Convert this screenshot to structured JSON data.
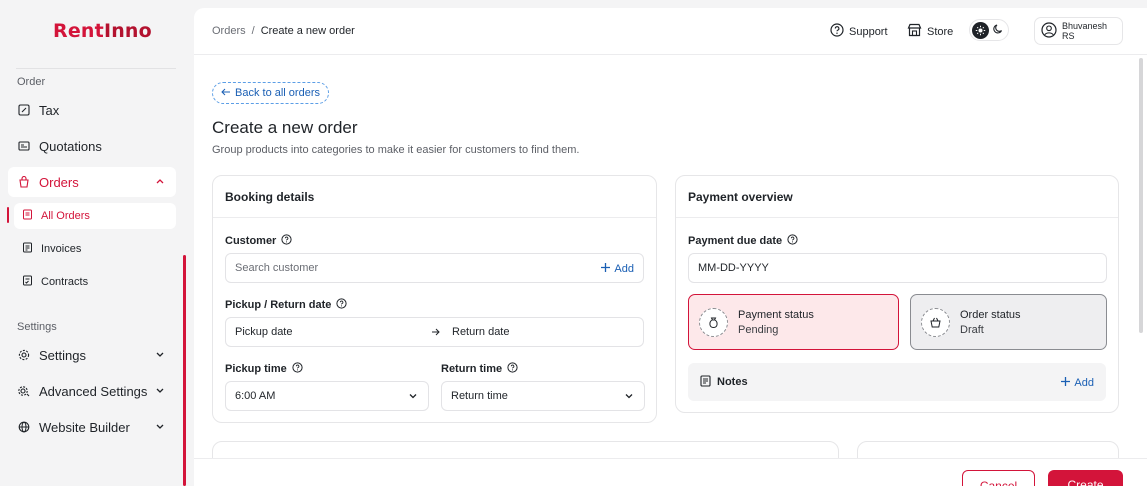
{
  "brand": {
    "logo_part1": "Rent",
    "logo_part2": "Inno",
    "color": "#d3143a"
  },
  "sidebar": {
    "section_order": "Order",
    "tax": "Tax",
    "quotations": "Quotations",
    "orders": "Orders",
    "all_orders": "All Orders",
    "invoices": "Invoices",
    "contracts": "Contracts",
    "section_settings": "Settings",
    "settings": "Settings",
    "advanced_settings": "Advanced Settings",
    "website_builder": "Website Builder"
  },
  "header": {
    "breadcrumb_root": "Orders",
    "breadcrumb_sep": "/",
    "breadcrumb_current": "Create a new order",
    "support": "Support",
    "store": "Store",
    "user_name": "Bhuvanesh RS"
  },
  "page": {
    "back_label": "Back to all orders",
    "title": "Create a new order",
    "subtitle": "Group products into categories to make it easier for customers to find them."
  },
  "booking": {
    "title": "Booking details",
    "customer_label": "Customer",
    "customer_placeholder": "Search customer",
    "add_label": "Add",
    "pickup_return_label": "Pickup / Return date",
    "pickup_date_placeholder": "Pickup date",
    "return_date_placeholder": "Return date",
    "pickup_time_label": "Pickup time",
    "pickup_time_value": "6:00 AM",
    "return_time_label": "Return time",
    "return_time_placeholder": "Return time"
  },
  "payment": {
    "title": "Payment overview",
    "due_date_label": "Payment due date",
    "due_date_placeholder": "MM-DD-YYYY",
    "payment_status_label": "Payment status",
    "payment_status_value": "Pending",
    "order_status_label": "Order status",
    "order_status_value": "Draft",
    "notes_label": "Notes",
    "notes_add": "Add"
  },
  "footer": {
    "cancel": "Cancel",
    "create": "Create"
  },
  "colors": {
    "accent": "#d3143a",
    "link": "#1a5fb4",
    "pending_bg": "#fde8ea",
    "draft_bg": "#eeeef0"
  }
}
